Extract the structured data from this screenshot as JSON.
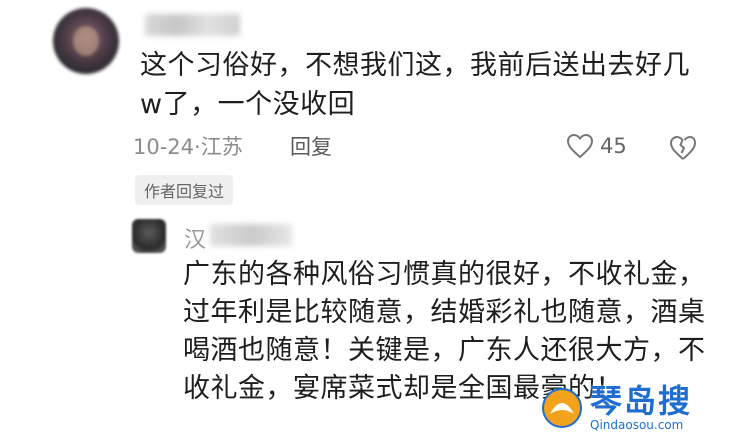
{
  "comment": {
    "text": "这个习俗好，不想我们这，我前后送出去好几w了，一个没收回",
    "date_location": "10-24·江苏",
    "reply_label": "回复",
    "like_count": "45",
    "author_replied_badge": "作者回复过"
  },
  "reply": {
    "name_visible": "汉",
    "text": "广东的各种风俗习惯真的很好，不收礼金，过年利是比较随意，结婚彩礼也随意，酒桌喝酒也随意！关键是，广东人还很大方，不收礼金，宴席菜式却是全国最豪的！"
  },
  "watermark": {
    "title": "琴岛搜",
    "url": "Qindaosou.com"
  },
  "colors": {
    "text": "#1e1e1e",
    "meta": "#8c8c8c",
    "watermark": "#1f6dd1"
  }
}
